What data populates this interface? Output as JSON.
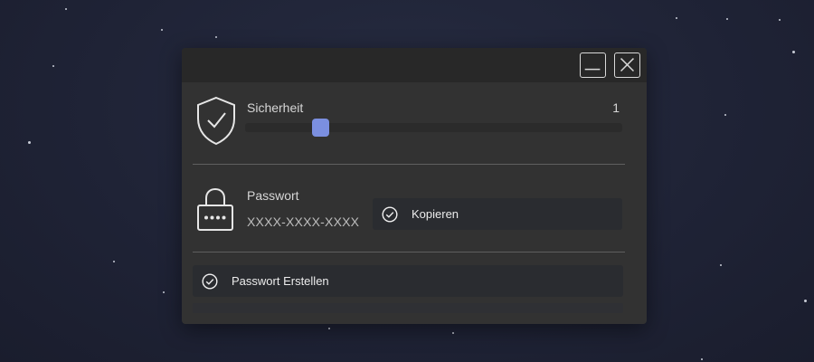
{
  "window": {
    "minimize_icon": "minimize-icon",
    "close_icon": "close-icon"
  },
  "security": {
    "label": "Sicherheit",
    "value": "1",
    "slider_level": 0.2,
    "icon": "shield-check-icon",
    "accent": "#7b8fe0"
  },
  "password": {
    "label": "Passwort",
    "value": "XXXX-XXXX-XXXX",
    "icon": "lock-icon"
  },
  "actions": {
    "copy_label": "Kopieren",
    "create_label": "Passwort Erstellen",
    "check_icon": "check-circle-icon"
  }
}
